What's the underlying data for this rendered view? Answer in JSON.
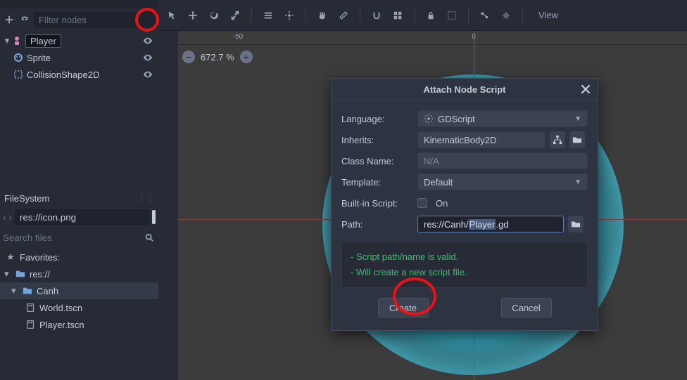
{
  "scene": {
    "filter_placeholder": "Filter nodes",
    "nodes": [
      {
        "name": "Player",
        "type": "kinematic"
      },
      {
        "name": "Sprite",
        "type": "sprite"
      },
      {
        "name": "CollisionShape2D",
        "type": "collision"
      }
    ]
  },
  "filesystem": {
    "header": "FileSystem",
    "path_value": "res://icon.png",
    "search_placeholder": "Search files",
    "favorites_label": "Favorites:",
    "root": "res://",
    "folder": "Canh",
    "files": [
      "World.tscn",
      "Player.tscn"
    ]
  },
  "viewport": {
    "view_label": "View",
    "zoom": "672.7 %",
    "ruler_ticks": [
      "-50",
      "0"
    ]
  },
  "dialog": {
    "title": "Attach Node Script",
    "labels": {
      "language": "Language:",
      "inherits": "Inherits:",
      "classname": "Class Name:",
      "template": "Template:",
      "builtin": "Built-in Script:",
      "path": "Path:"
    },
    "values": {
      "language": "GDScript",
      "inherits": "KinematicBody2D",
      "classname": "N/A",
      "template": "Default",
      "builtin": "On",
      "path_prefix": "res://Canh/",
      "path_sel": "Player",
      "path_suffix": ".gd"
    },
    "status": [
      "- Script path/name is valid.",
      "- Will create a new script file."
    ],
    "buttons": {
      "create": "Create",
      "cancel": "Cancel"
    }
  }
}
